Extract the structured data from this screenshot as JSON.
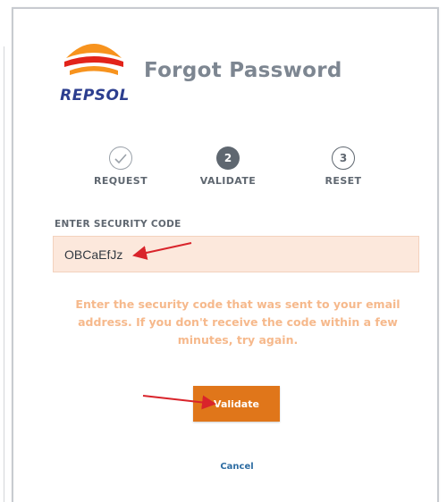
{
  "brand": {
    "name": "REPSOL",
    "colors": {
      "orange": "#f7931e",
      "red": "#e2231a",
      "navy": "#2c3e8f"
    }
  },
  "header": {
    "title": "Forgot Password"
  },
  "steps": [
    {
      "number": "",
      "label": "REQUEST",
      "state": "done"
    },
    {
      "number": "2",
      "label": "VALIDATE",
      "state": "active"
    },
    {
      "number": "3",
      "label": "RESET",
      "state": "pending"
    }
  ],
  "form": {
    "code_label": "ENTER SECURITY CODE",
    "code_value": "OBCaEfJz",
    "help_text": "Enter the security code that was sent to your email address. If you don't receive the code within a few minutes, try again.",
    "validate_label": "Validate",
    "cancel_label": "Cancel"
  },
  "colors": {
    "accent": "#e0761a",
    "input_bg": "#fce8dc",
    "help_text": "#f6b98c",
    "link": "#2d6ca2",
    "annotation_arrow": "#d9242b"
  }
}
